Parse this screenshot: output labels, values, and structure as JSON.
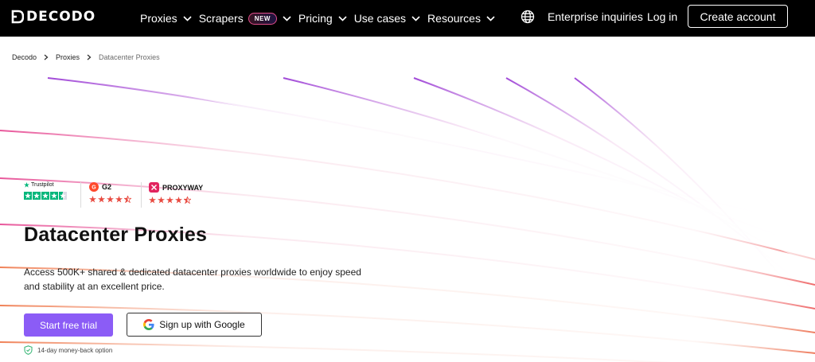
{
  "nav": {
    "brand": "DECODO",
    "items": [
      {
        "label": "Proxies"
      },
      {
        "label": "Scrapers",
        "badge": "NEW"
      },
      {
        "label": "Pricing"
      },
      {
        "label": "Use cases"
      },
      {
        "label": "Resources"
      }
    ],
    "language_icon": "globe-icon",
    "enterprise_label": "Enterprise inquiries",
    "login_label": "Log in",
    "create_account_label": "Create account"
  },
  "breadcrumb": {
    "items": [
      "Decodo",
      "Proxies",
      "Datacenter Proxies"
    ]
  },
  "ratings": [
    {
      "name": "Trustpilot",
      "stars": 4.5,
      "color": "#00b67a"
    },
    {
      "name": "G2",
      "stars": 4.5,
      "color": "#e8493f"
    },
    {
      "name": "PROXYWAY",
      "stars": 4.5,
      "color": "#e8493f"
    }
  ],
  "hero": {
    "title": "Datacenter Proxies",
    "description": "Access 500K+ shared & dedicated datacenter proxies worldwide to enjoy speed and stability at an excellent price.",
    "primary_cta": "Start free trial",
    "google_cta": "Sign up with Google",
    "guarantee": "14-day money-back option"
  },
  "colors": {
    "nav_bg": "#000000",
    "accent": "#8b5cf6",
    "trustpilot_green": "#00b67a",
    "star_red": "#e8493f"
  }
}
